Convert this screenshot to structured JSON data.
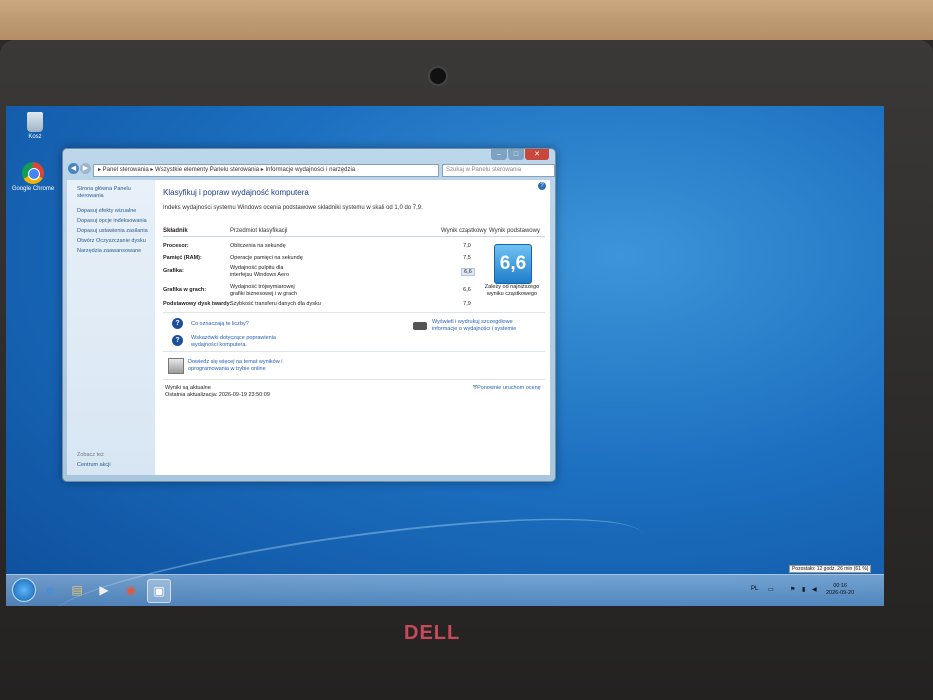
{
  "desktop": {
    "icons": [
      {
        "label": "Kosz",
        "icon": "recycle-bin-icon"
      },
      {
        "label": "Google Chrome",
        "icon": "chrome-icon"
      }
    ]
  },
  "window": {
    "breadcrumb": "▸ Panel sterowania ▸ Wszystkie elementy Panelu sterowania ▸ Informacje wydajności i narzędzia",
    "search_placeholder": "Szukaj w Panelu sterowania",
    "controls": {
      "minimize": "–",
      "maximize": "□",
      "close": "✕"
    },
    "sidebar": {
      "items": [
        "Strona główna Panelu sterowania",
        "Dopasuj efekty wizualne",
        "Dopasuj opcje indeksowania",
        "Dopasuj ustawienia zasilania",
        "Otwórz Oczyszczanie dysku",
        "Narzędzia zaawansowane"
      ],
      "see_also_label": "Zobacz też",
      "see_also_items": [
        "Centrum akcji"
      ]
    },
    "content": {
      "title": "Klasyfikuj i popraw wydajność komputera",
      "description": "Indeks wydajności systemu Windows ocenia podstawowe składniki systemu w skali od 1,0 do 7,9.",
      "headers": {
        "component": "Składnik",
        "rated": "Przedmiot klasyfikacji",
        "subscore": "Wynik cząstkowy",
        "basescore": "Wynik podstawowy"
      },
      "rows": [
        {
          "component": "Procesor:",
          "rated": "Obliczenia na sekundę",
          "score": "7,0"
        },
        {
          "component": "Pamięć (RAM):",
          "rated": "Operacje pamięci na sekundę",
          "score": "7,5"
        },
        {
          "component": "Grafika:",
          "rated": "Wydajność pulpitu dla interfejsu Windows Aero",
          "score": "6,6"
        },
        {
          "component": "Grafika w grach:",
          "rated": "Wydajność trójwymiarowej grafiki biznesowej i w grach",
          "score": "6,6"
        },
        {
          "component": "Podstawowy dysk twardy:",
          "rated": "Szybkość transferu danych dla dysku",
          "score": "7,9"
        }
      ],
      "base_score": "6,6",
      "base_caption": "Zależy od najniższego wyniku cząstkowego",
      "links": {
        "what_numbers": "Co oznaczają te liczby?",
        "tips": "Wskazówki dotyczące poprawienia wydajności komputera.",
        "print_details": "Wyświetl i wydrukuj szczegółowe informacje o wydajności i systemie",
        "learn_more": "Dowiedz się więcej na temat wyników i oprogramowania w trybie online"
      },
      "status": {
        "current": "Wyniki są aktualne",
        "last_update": "Ostatnia aktualizacja: 2026-09-19 23:50:09"
      },
      "rerun": "Ponownie uruchom ocenę"
    }
  },
  "taskbar": {
    "tray": "PL",
    "clock_time": "00:16",
    "clock_date": "2026-09-20",
    "battery_tooltip": "Pozostało: 12 godz. 26 min (61 %)"
  },
  "bezel": {
    "brand": "DELL"
  }
}
